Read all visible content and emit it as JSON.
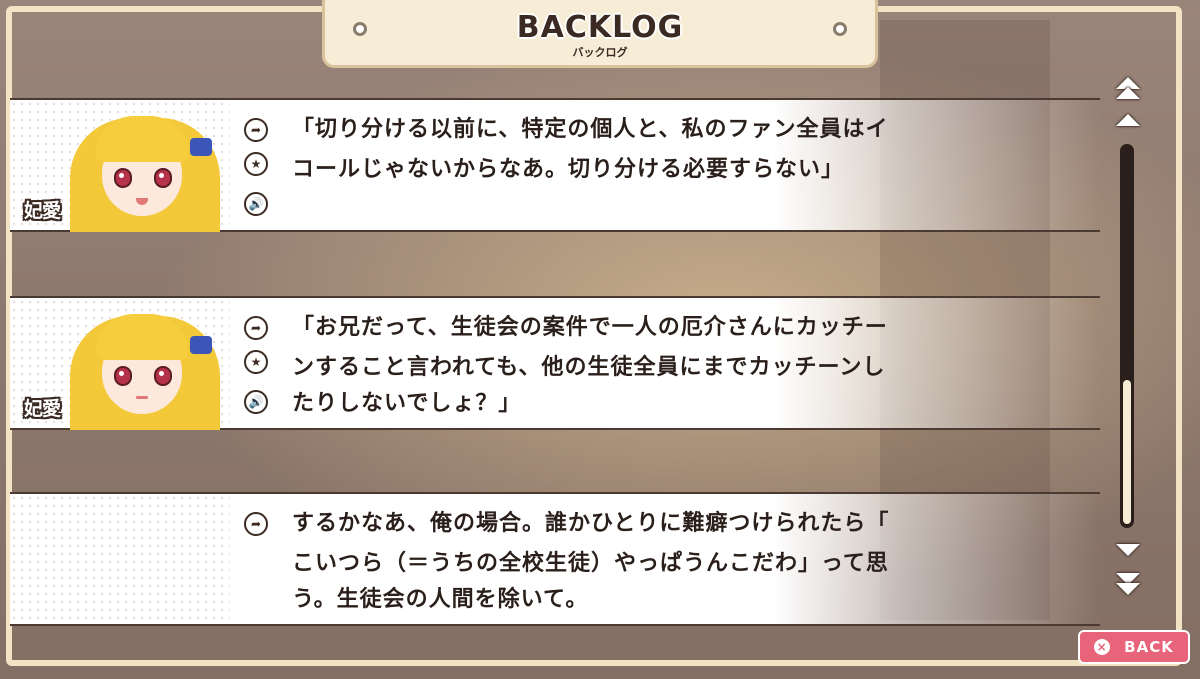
{
  "header": {
    "title": "BACKLOG",
    "subtitle": "バックログ"
  },
  "entries": [
    {
      "speaker": "妃愛",
      "line1": "「切り分ける以前に、特定の個人と、私のファン全員はイ",
      "line2": "コールじゃないからなあ。切り分ける必要すらない」",
      "line3": ""
    },
    {
      "speaker": "妃愛",
      "line1": "「お兄だって、生徒会の案件で一人の厄介さんにカッチー",
      "line2": "ンすること言われても、他の生徒全員にまでカッチーンし",
      "line3": "たりしないでしょ？」"
    },
    {
      "speaker": "",
      "line1": "するかなあ、俺の場合。誰かひとりに難癖つけられたら「",
      "line2": "こいつら（＝うちの全校生徒）やっぱうんこだわ」って思",
      "line3": "う。生徒会の人間を除いて。"
    }
  ],
  "icons": {
    "jump": "arrow-jump-icon",
    "favorite": "star-icon",
    "voice": "speaker-icon"
  },
  "back_button": {
    "label": "BACK",
    "icon": "×"
  },
  "colors": {
    "accent": "#e8647a",
    "panel": "#f7ecd6",
    "text": "#2a1f1a",
    "hair": "#f3c93a"
  }
}
